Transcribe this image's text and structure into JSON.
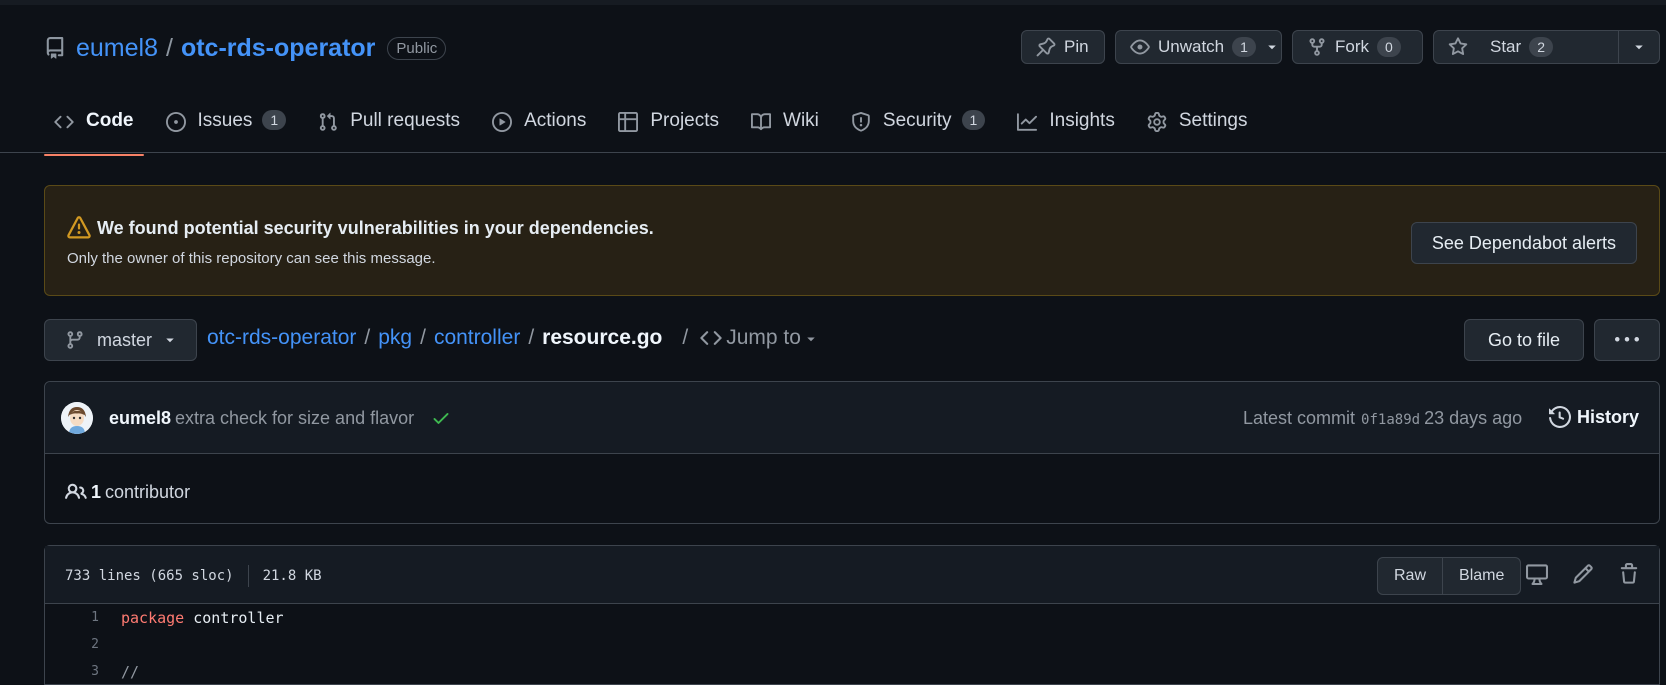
{
  "repo": {
    "owner": "eumel8",
    "separator": "/",
    "name": "otc-rds-operator",
    "visibility": "Public"
  },
  "header_buttons": {
    "pin": "Pin",
    "watch": {
      "label": "Unwatch",
      "count": "1"
    },
    "fork": {
      "label": "Fork",
      "count": "0"
    },
    "star": {
      "label": "Star",
      "count": "2"
    }
  },
  "tabs": [
    {
      "label": "Code",
      "icon": "code-icon",
      "active": true
    },
    {
      "label": "Issues",
      "icon": "issue-icon",
      "count": "1"
    },
    {
      "label": "Pull requests",
      "icon": "pull-request-icon"
    },
    {
      "label": "Actions",
      "icon": "play-icon"
    },
    {
      "label": "Projects",
      "icon": "table-icon"
    },
    {
      "label": "Wiki",
      "icon": "book-icon"
    },
    {
      "label": "Security",
      "icon": "shield-icon",
      "count": "1"
    },
    {
      "label": "Insights",
      "icon": "graph-icon"
    },
    {
      "label": "Settings",
      "icon": "gear-icon"
    }
  ],
  "alert": {
    "title": "We found potential security vulnerabilities in your dependencies.",
    "subtitle": "Only the owner of this repository can see this message.",
    "button": "See Dependabot alerts"
  },
  "breadcrumb": {
    "branch": "master",
    "parts": [
      "otc-rds-operator",
      "pkg",
      "controller"
    ],
    "current": "resource.go",
    "sep": "/",
    "jump": "Jump to"
  },
  "file_actions": {
    "goto": "Go to file",
    "more": "more-icon"
  },
  "commit": {
    "author": "eumel8",
    "message": "extra check for size and flavor",
    "latest_label": "Latest commit",
    "sha": "0f1a89d",
    "when": "23 days ago",
    "history": "History"
  },
  "contributors": {
    "count": "1",
    "label": "contributor"
  },
  "file": {
    "lines": "733 lines (665 sloc)",
    "size": "21.8 KB",
    "raw": "Raw",
    "blame": "Blame"
  },
  "code": [
    {
      "n": "1",
      "kw": "package",
      "rest": " controller"
    },
    {
      "n": "2",
      "kw": "",
      "rest": ""
    },
    {
      "n": "3",
      "kw": "",
      "rest": ""
    }
  ],
  "colors": {
    "background": "#0d1117",
    "link": "#4493f8",
    "active_tab_underline": "#f78166",
    "alert_bg": "#272115",
    "warning": "#d29922",
    "success": "#3fb950",
    "keyword": "#ff7b72"
  }
}
